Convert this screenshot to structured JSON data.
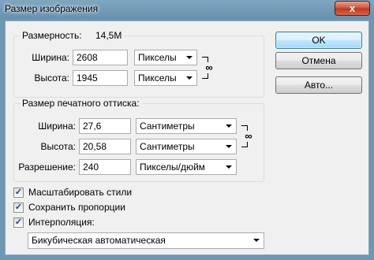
{
  "window": {
    "title": "Размер изображения",
    "close_glyph": "x"
  },
  "pixel_dimensions": {
    "label": "Размерность:",
    "value": "14,5M",
    "width_label": "Ширина:",
    "width_value": "2608",
    "width_unit": "Пикселы",
    "height_label": "Высота:",
    "height_value": "1945",
    "height_unit": "Пикселы"
  },
  "document_size": {
    "title": "Размер печатного оттиска:",
    "width_label": "Ширина:",
    "width_value": "27,6",
    "width_unit": "Сантиметры",
    "height_label": "Высота:",
    "height_value": "20,58",
    "height_unit": "Сантиметры",
    "resolution_label": "Разрешение:",
    "resolution_value": "240",
    "resolution_unit": "Пикселы/дюйм"
  },
  "buttons": {
    "ok": "OK",
    "cancel": "Отмена",
    "auto": "Авто..."
  },
  "options": {
    "scale_styles": {
      "label": "Масштабировать стили",
      "checked": true
    },
    "constrain_proportions": {
      "label": "Сохранить пропорции",
      "checked": true
    },
    "resample": {
      "label": "Интерполяция:",
      "checked": true
    },
    "resample_method": "Бикубическая автоматическая"
  },
  "icons": {
    "link": "chain-link-icon",
    "dropdown": "chevron-down-icon",
    "check": "checkmark-icon"
  }
}
